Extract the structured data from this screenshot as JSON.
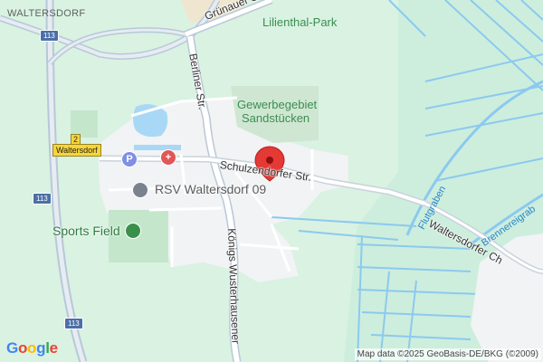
{
  "map": {
    "places": {
      "town": "WALTERSDORF",
      "park": "Lilienthal-Park",
      "industrial_line1": "Gewerbegebiet",
      "industrial_line2": "Sandstücken"
    },
    "streets": {
      "gruenauer": "Grünauer Str.",
      "berliner": "Berliner Str.",
      "schulzendorfer": "Schulzendorfer Str.",
      "koenigs": "Königs Wusterhausener",
      "waltersdorfer_ch": "Waltersdorfer Ch"
    },
    "waterways": {
      "flutgraben": "Flutgraben",
      "brennereigraben": "Brennereigrab"
    },
    "shields": {
      "a113_top": "113",
      "a113_mid": "113",
      "a113_bottom": "113",
      "route2": "2",
      "town_sign": "Waltersdorf"
    },
    "pois": {
      "rsv": "RSV Waltersdorf 09",
      "sports_field": "Sports Field",
      "parking_symbol": "P",
      "hospital_symbol": "+"
    },
    "attribution": "Map data ©2025 GeoBasis-DE/BKG (©2009)",
    "logo_letters": [
      "G",
      "o",
      "o",
      "g",
      "l",
      "e"
    ],
    "logo_colors": [
      "#4285F4",
      "#EA4335",
      "#FBBC05",
      "#4285F4",
      "#34A853",
      "#EA4335"
    ],
    "colors": {
      "background": "#d9f2e2",
      "urban": "#f1f3f4",
      "water": "#a8d8f5",
      "road": "#ffffff",
      "motorway": "#b8c8d8",
      "park": "#c4e7cc",
      "marker": "#e53935"
    }
  }
}
